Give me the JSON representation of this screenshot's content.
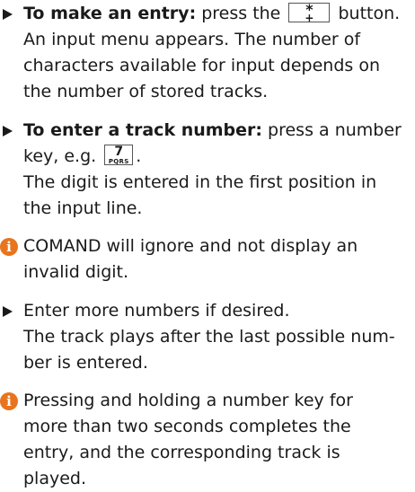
{
  "accent_color": "#e8741d",
  "items": [
    {
      "type": "bullet",
      "lead": "To make an entry:",
      "line1_after_lead": " press the",
      "line1_tail": " button.",
      "key": {
        "top": "*",
        "bottom": "+"
      },
      "lines": [
        "An input menu appears. The number of",
        "characters available for input depends on",
        "the number of stored tracks."
      ]
    },
    {
      "type": "bullet",
      "lead": "To enter a track number:",
      "line1_after_lead": " press a number",
      "line2_prefix": "key, e.g. ",
      "line2_suffix": ".",
      "key": {
        "top": "7",
        "bottom": "PQRS"
      },
      "lines": [
        "The digit is entered in the first position in",
        "the input line."
      ]
    },
    {
      "type": "info",
      "icon": "info-icon",
      "lines": [
        "COMAND will ignore and not display an",
        "invalid digit."
      ]
    },
    {
      "type": "bullet",
      "lines": [
        "Enter more numbers if desired.",
        "The track plays after the last possible num-",
        "ber is entered."
      ]
    },
    {
      "type": "info",
      "icon": "info-icon",
      "lines": [
        "Pressing and holding a number key for",
        "more than two seconds completes the",
        "entry, and the corresponding track is",
        "played."
      ]
    }
  ]
}
